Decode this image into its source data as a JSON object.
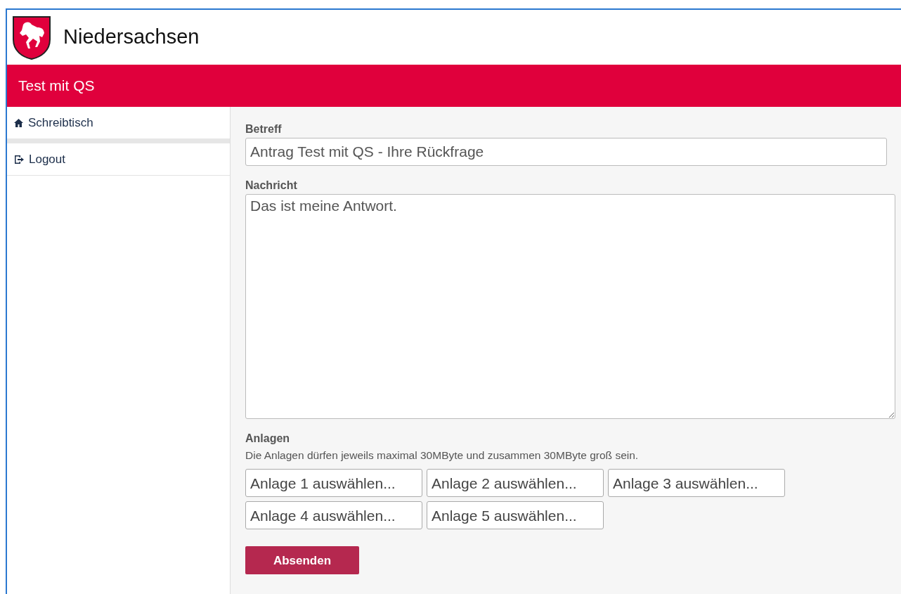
{
  "header": {
    "title": "Niedersachsen"
  },
  "banner": {
    "title": "Test mit QS"
  },
  "sidebar": {
    "items": [
      {
        "label": "Schreibtisch",
        "kind": "home"
      },
      {
        "label": "Logout",
        "kind": "logout"
      }
    ]
  },
  "form": {
    "subject": {
      "label": "Betreff",
      "value": "Antrag Test mit QS - Ihre Rückfrage"
    },
    "message": {
      "label": "Nachricht",
      "value": "Das ist meine Antwort."
    },
    "attachments": {
      "label": "Anlagen",
      "hint": "Die Anlagen dürfen jeweils maximal 30MByte und zusammen 30MByte groß sein.",
      "buttons": [
        "Anlage 1 auswählen...",
        "Anlage 2 auswählen...",
        "Anlage 3 auswählen...",
        "Anlage 4 auswählen...",
        "Anlage 5 auswählen..."
      ]
    },
    "submit": "Absenden"
  }
}
